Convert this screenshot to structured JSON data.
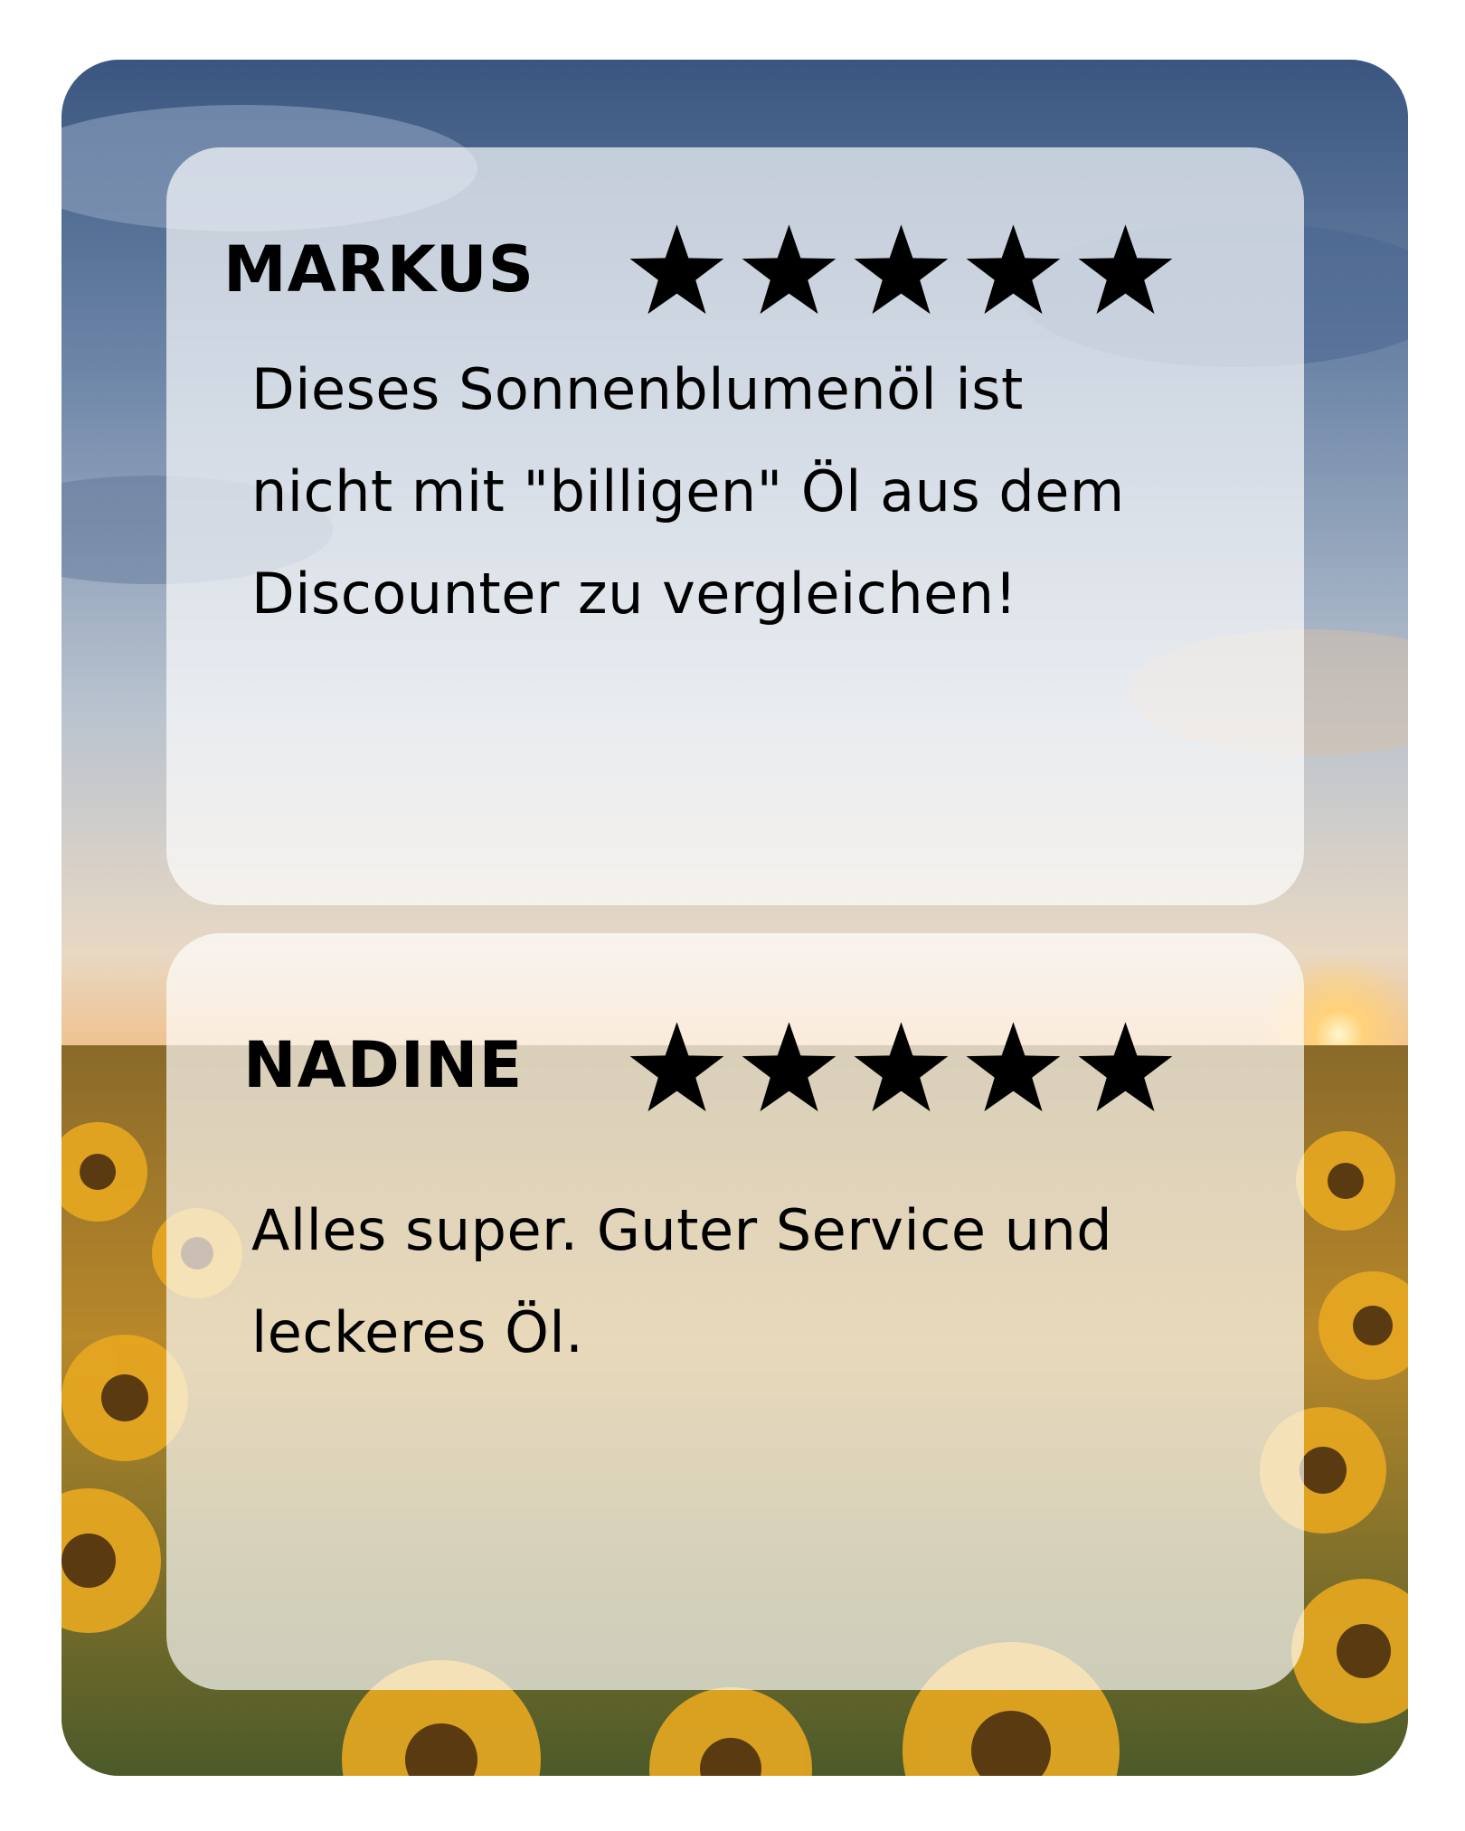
{
  "reviews": [
    {
      "name": "MARKUS",
      "rating": 5,
      "text": "Dieses Sonnenblumenöl ist nicht mit \"billigen\" Öl aus dem Discounter zu vergleichen!"
    },
    {
      "name": "NADINE",
      "rating": 5,
      "text": "Alles super. Guter Service und leckeres Öl."
    }
  ],
  "icons": {
    "star": "star-icon"
  },
  "colors": {
    "text": "#000000",
    "card": "rgba(255,255,255,0.68)",
    "sky_top": "#3d5a82",
    "sun": "#ffb347",
    "sunflower": "#e0a020"
  }
}
